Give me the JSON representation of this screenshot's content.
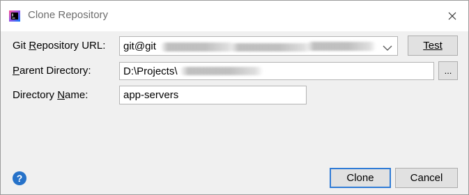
{
  "window": {
    "title": "Clone Repository",
    "app_icon": "intellij-app-icon",
    "close_icon": "close-icon"
  },
  "form": {
    "git_url": {
      "label": "Git Repository URL:",
      "mnemonic": "R",
      "value": "git@git"
    },
    "parent_directory": {
      "label": "Parent Directory:",
      "mnemonic": "P",
      "value": "D:\\Projects\\"
    },
    "directory_name": {
      "label": "Directory Name:",
      "mnemonic": "N",
      "value": "app-servers"
    }
  },
  "buttons": {
    "test": "Test",
    "browse": "...",
    "clone": "Clone",
    "cancel": "Cancel",
    "help": "?"
  },
  "colors": {
    "accent": "#2f7bd6",
    "help": "#2672c9",
    "dialog_bg": "#f0f0f0"
  }
}
